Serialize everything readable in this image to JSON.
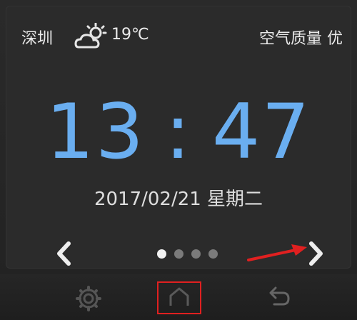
{
  "status": {
    "city": "深圳",
    "weather_icon": "partly-cloudy-icon",
    "temperature": "19℃",
    "air_quality": "空气质量 优"
  },
  "clock": {
    "hours": "13",
    "separator": ":",
    "minutes": "47"
  },
  "date": "2017/02/21 星期二",
  "pager": {
    "total": 4,
    "active_index": 0
  },
  "nav": {
    "settings_icon": "gear-icon",
    "home_icon": "home-icon",
    "back_icon": "back-icon",
    "highlighted": "home"
  },
  "colors": {
    "clock": "#6aaef0",
    "annotation": "#e02020",
    "background": "#2b2b2b"
  }
}
